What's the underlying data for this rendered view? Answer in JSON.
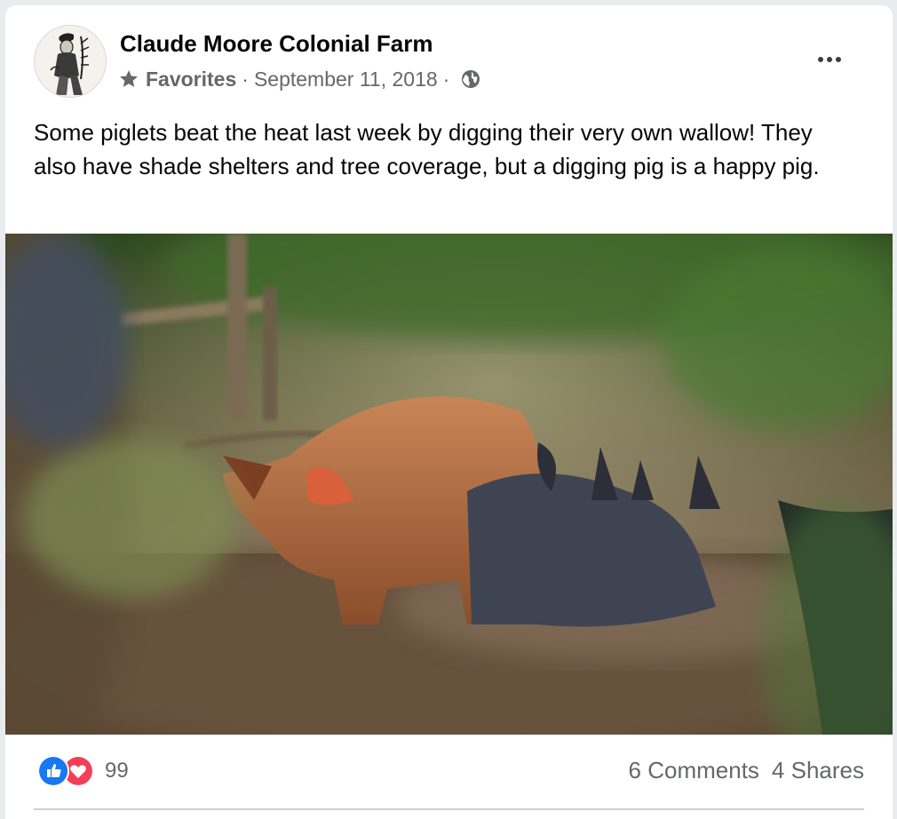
{
  "post": {
    "author": "Claude Moore Colonial Farm",
    "audience": "Favorites",
    "separator": "·",
    "date": "September 11, 2018",
    "privacy_icon": "globe-icon",
    "audience_icon": "star-icon",
    "text": "Some piglets beat the heat last week by digging their very own wallow! They also have shade shelters and tree coverage, but a digging pig is a happy pig."
  },
  "footer": {
    "reaction_count": "99",
    "comments": "6 Comments",
    "shares": "4 Shares"
  },
  "colors": {
    "like": "#1877f2",
    "love": "#f33e58",
    "secondary_text": "#65676b",
    "primary_text": "#050505"
  }
}
